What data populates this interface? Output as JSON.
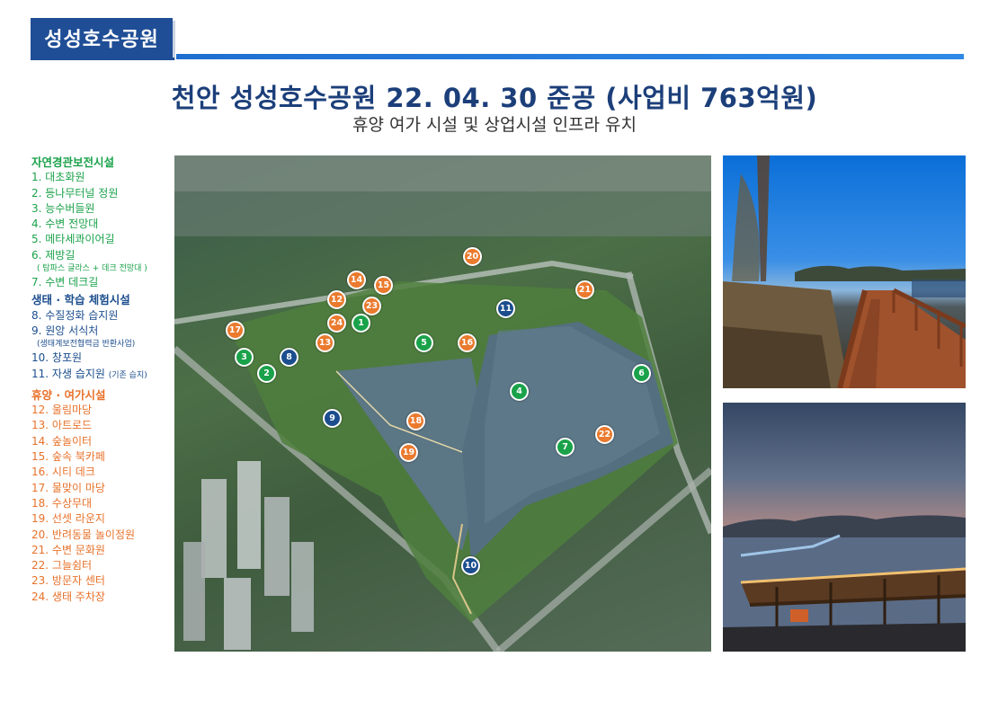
{
  "header": {
    "tab_label": "성성호수공원"
  },
  "title": "천안 성성호수공원 22. 04. 30 준공 (사업비 763억원)",
  "subtitle": "휴양 여가 시설 및 상업시설 인프라 유치",
  "colors": {
    "green": "#1aa24a",
    "blue": "#1c4e8e",
    "orange": "#e8712a",
    "header": "#1f4e96"
  },
  "legend": {
    "green_title": "자연경관보전시설",
    "green_items": [
      "1. 대초화원",
      "2. 등나무터널 정원",
      "3. 능수버들원",
      "4. 수변 전망대",
      "5. 메타세콰이어길",
      "6. 제방길"
    ],
    "green_note": "( 탐파스 글라스 + 데크 전망대 )",
    "green_item7": "7. 수변 데크길",
    "blue_title": "생태 · 학습 체험시설",
    "blue_items": [
      "8. 수질정화 습지원",
      "9. 원앙 서식처"
    ],
    "blue_note": "(생태계보전협력금 반환사업)",
    "blue_item10": "10. 창포원",
    "blue_item11": "11. 자생 습지원",
    "blue_item11_note": "(기존 습지)",
    "orange_title": "휴양 · 여가시설",
    "orange_items": [
      "12. 울림마당",
      "13. 아트로드",
      "14. 숲놀이터",
      "15. 숲속 북카페",
      "16. 시티 데크",
      "17. 물맞이 마당",
      "18. 수상무대",
      "19. 선셋 라운지",
      "20. 반려동물 놀이정원",
      "21. 수변 문화원",
      "22. 그늘쉼터",
      "23. 방문자 센터",
      "24. 생태 주차장"
    ]
  },
  "markers": [
    {
      "n": "1",
      "c": "g"
    },
    {
      "n": "2",
      "c": "g"
    },
    {
      "n": "3",
      "c": "g"
    },
    {
      "n": "4",
      "c": "g"
    },
    {
      "n": "5",
      "c": "g"
    },
    {
      "n": "6",
      "c": "g"
    },
    {
      "n": "7",
      "c": "g"
    },
    {
      "n": "8",
      "c": "b"
    },
    {
      "n": "9",
      "c": "b"
    },
    {
      "n": "10",
      "c": "b"
    },
    {
      "n": "11",
      "c": "b"
    },
    {
      "n": "12",
      "c": "o"
    },
    {
      "n": "13",
      "c": "o"
    },
    {
      "n": "14",
      "c": "o"
    },
    {
      "n": "15",
      "c": "o"
    },
    {
      "n": "16",
      "c": "o"
    },
    {
      "n": "17",
      "c": "o"
    },
    {
      "n": "18",
      "c": "o"
    },
    {
      "n": "19",
      "c": "o"
    },
    {
      "n": "20",
      "c": "o"
    },
    {
      "n": "21",
      "c": "o"
    },
    {
      "n": "22",
      "c": "o"
    },
    {
      "n": "23",
      "c": "o"
    },
    {
      "n": "24",
      "c": "o"
    }
  ]
}
